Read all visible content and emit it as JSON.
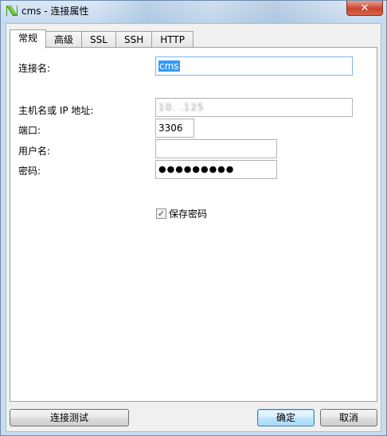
{
  "window": {
    "title": "cms - 连接属性",
    "close_label": "✕",
    "icon": "navicat-app-icon"
  },
  "tabs": [
    {
      "label": "常规",
      "active": true
    },
    {
      "label": "高级",
      "active": false
    },
    {
      "label": "SSL",
      "active": false
    },
    {
      "label": "SSH",
      "active": false
    },
    {
      "label": "HTTP",
      "active": false
    }
  ],
  "form": {
    "connection_name_label": "连接名:",
    "connection_name_value": "cms",
    "host_label": "主机名或 IP 地址:",
    "host_value": "10.  .125",
    "port_label": "端口:",
    "port_value": "3306",
    "username_label": "用户名:",
    "username_value": "",
    "password_label": "密码:",
    "password_value": "●●●●●●●●●",
    "save_password_label": "保存密码",
    "save_password_checked": true
  },
  "buttons": {
    "test_connection": "连接测试",
    "ok": "确定",
    "cancel": "取消"
  }
}
